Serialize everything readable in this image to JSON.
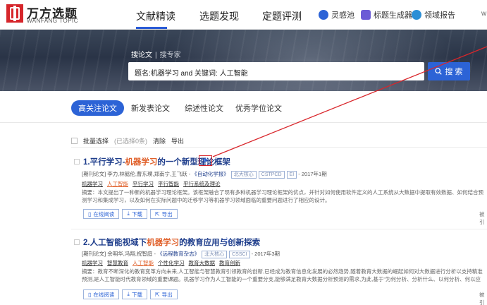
{
  "header": {
    "logo_cn": "万方选题",
    "logo_en": "WANFANG TOPIC",
    "nav": [
      "文献精读",
      "选题发现",
      "定题评测"
    ],
    "tools": [
      {
        "label": "灵感池",
        "color": "#2c63d6"
      },
      {
        "label": "标题生成器",
        "color": "#6b5bd6"
      },
      {
        "label": "领域报告",
        "color": "#2c8fd6"
      }
    ],
    "user": "w"
  },
  "search": {
    "tab_active": "搜论文",
    "tab_other": "搜专家",
    "query": "题名:机器学习 and 关键词: 人工智能",
    "button_label": "搜 索"
  },
  "categories": [
    "高关注论文",
    "新发表论文",
    "综述性论文",
    "优秀学位论文"
  ],
  "toolbar": {
    "batch": "批量选择",
    "selected": "(已选择0条)",
    "clear": "清除",
    "export": "导出"
  },
  "results": [
    {
      "title_pre": "1.平行学习-",
      "title_hl": "机器学习",
      "title_post": "的一个新型理论框架",
      "meta_pre": "[期刊论文] 李力,林懿伦,曹东璞,郑南宁,王飞跃 - ",
      "source": "《自动化学报》",
      "badges": [
        "北大核心",
        "CSTPCD",
        "EI"
      ],
      "meta_post": " - 2017年1期",
      "keywords": [
        {
          "text": "机器学习",
          "hl": false
        },
        {
          "text": "人工智能",
          "hl": true
        },
        {
          "text": "平行学习",
          "hl": false
        },
        {
          "text": "平行智能",
          "hl": false
        },
        {
          "text": "平行系统及理论",
          "hl": false
        }
      ],
      "abstract": "摘要：本文提出了一种新的机器学习理论框架。该框架融合了现有多种机器学习理论框架的优点，并针对如何使用软件定义的人工系统从大数据中提取有效数据、如何结合预测学习和集成学习，以及如何在实际问题中的迁移学习等机器学习领域面临的重要问题进行了相应的设计。",
      "actions": [
        "在线阅读",
        "下载",
        "导出"
      ],
      "side": "被引"
    },
    {
      "title_pre": "2.人工智能视域下",
      "title_hl": "机器学习",
      "title_post": "的教育应用与创新探索",
      "meta_pre": "[期刊论文] 余明华,冯翔,祝智庭 - ",
      "source": "《远程教育杂志》",
      "badges": [
        "北大核心",
        "CSSCI"
      ],
      "meta_post": " - 2017年3期",
      "keywords": [
        {
          "text": "机器学习",
          "hl": false
        },
        {
          "text": "智慧教育",
          "hl": false
        },
        {
          "text": "人工智能",
          "hl": true
        },
        {
          "text": "个性化学习",
          "hl": false
        },
        {
          "text": "教育大数据",
          "hl": false
        },
        {
          "text": "教育创新",
          "hl": false
        }
      ],
      "abstract": "摘要：教育不断深化的教育变革方向未来,人工智能与智慧教育引领教育的创新,已经成为教育信息化发展的必然趋势,随着教育大数据的崛起如何对大数据进行分析以支持精准预测,是人工智能时代教育领域的重要课题。机器学习作为人工智能的一个重要分支,能够满足教育大数据分析预测的需求,为此,基于\"为何分析、分析什么、以何分析、何以应用\"一系列问题,通过对机器学习的作用对象、作用过程、具体方法和相应研究进行综述。",
      "actions": [
        "在线阅读",
        "下载",
        "导出"
      ],
      "side": "被引"
    }
  ],
  "colors": {
    "accent": "#2c63d6",
    "highlight": "#e0602a",
    "annotation": "#d9262b"
  }
}
